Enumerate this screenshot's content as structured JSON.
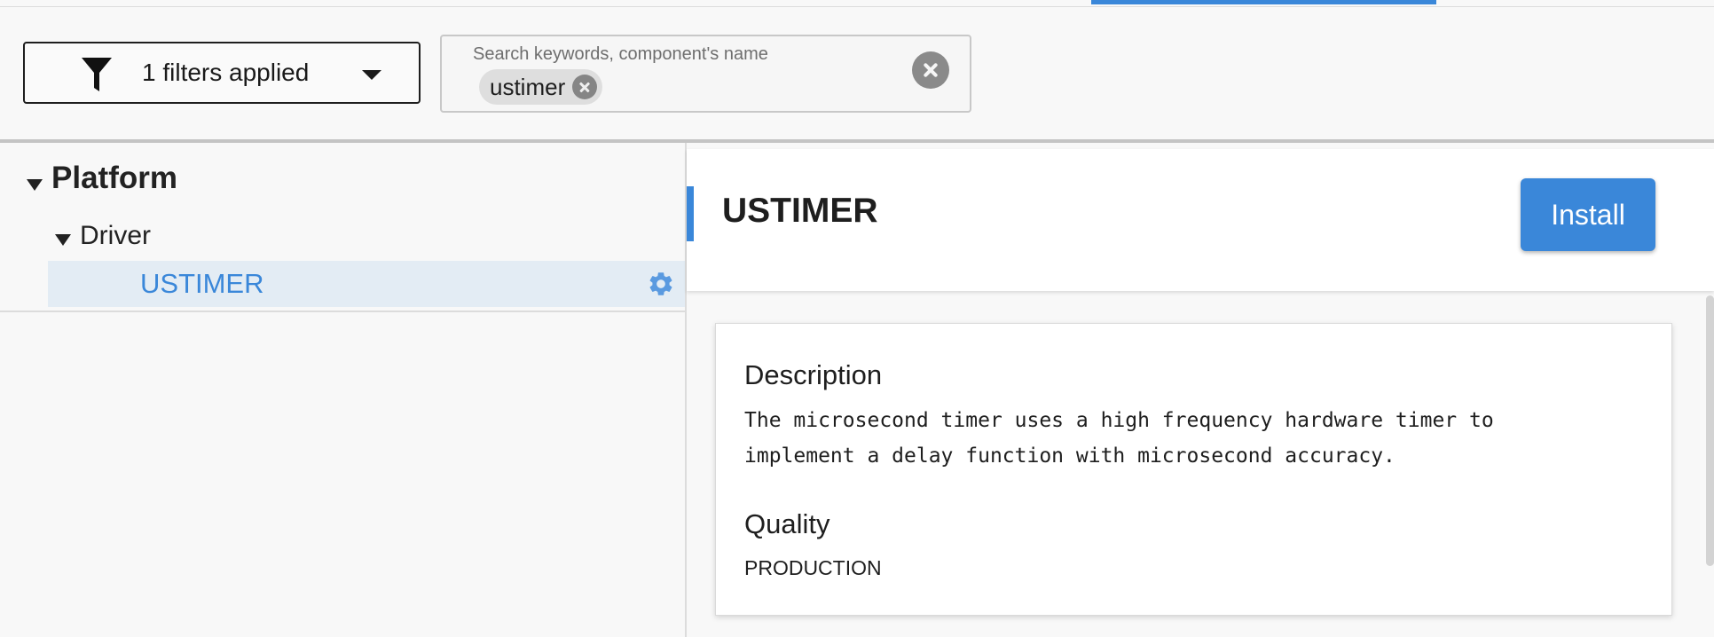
{
  "filter": {
    "label": "1 filters applied",
    "icon": "filter-icon",
    "dropdown_icon": "caret-down-icon"
  },
  "search": {
    "placeholder": "Search keywords, component's name",
    "chips": [
      {
        "label": "ustimer"
      }
    ],
    "clear_icon": "close-circle-icon"
  },
  "tree": {
    "nodes": [
      {
        "label": "Platform",
        "expanded": true,
        "children": [
          {
            "label": "Driver",
            "expanded": true,
            "children": [
              {
                "label": "USTIMER",
                "selected": true
              }
            ]
          }
        ]
      }
    ]
  },
  "component": {
    "title": "USTIMER",
    "install_label": "Install",
    "description_heading": "Description",
    "description_lines": [
      "The microsecond timer uses a high frequency hardware timer to",
      "implement a delay function with microsecond accuracy."
    ],
    "quality_heading": "Quality",
    "quality_value": "PRODUCTION"
  },
  "colors": {
    "accent": "#3a87d9",
    "selected_row": "#e3ecf4",
    "background": "#f8f8f8"
  }
}
